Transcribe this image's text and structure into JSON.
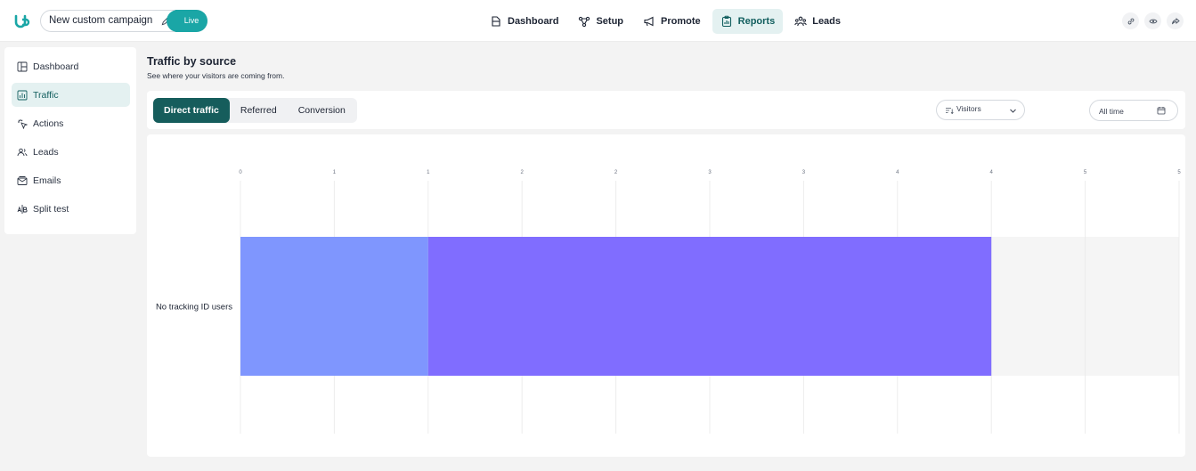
{
  "header": {
    "campaign_name": "New custom campaign",
    "status_label": "Live",
    "nav": [
      {
        "label": "Dashboard",
        "icon": "dashboard-icon",
        "active": false
      },
      {
        "label": "Setup",
        "icon": "setup-icon",
        "active": false
      },
      {
        "label": "Promote",
        "icon": "megaphone-icon",
        "active": false
      },
      {
        "label": "Reports",
        "icon": "clipboard-icon",
        "active": true
      },
      {
        "label": "Leads",
        "icon": "people-icon",
        "active": false
      }
    ],
    "actions": [
      "link-icon",
      "eye-icon",
      "share-icon"
    ]
  },
  "sidebar": {
    "items": [
      {
        "label": "Dashboard",
        "icon": "layout-icon",
        "active": false
      },
      {
        "label": "Traffic",
        "icon": "bar-chart-icon",
        "active": true
      },
      {
        "label": "Actions",
        "icon": "click-icon",
        "active": false
      },
      {
        "label": "Leads",
        "icon": "users-icon",
        "active": false
      },
      {
        "label": "Emails",
        "icon": "mail-icon",
        "active": false
      },
      {
        "label": "Split test",
        "icon": "split-icon",
        "active": false
      }
    ]
  },
  "main": {
    "title": "Traffic by source",
    "subtitle": "See where your visitors are coming from.",
    "tabs": [
      {
        "label": "Direct traffic",
        "active": true
      },
      {
        "label": "Referred",
        "active": false
      },
      {
        "label": "Conversion",
        "active": false
      }
    ],
    "metric_select": "Visitors",
    "date_range": "All time"
  },
  "colors": {
    "accent": "#165d5c",
    "live": "#1aa6a6",
    "bar1": "#7f96fe",
    "bar2": "#806dff"
  },
  "chart_data": {
    "type": "bar",
    "orientation": "horizontal",
    "stacked": true,
    "categories": [
      "No tracking ID users"
    ],
    "series": [
      {
        "values": [
          1
        ],
        "color": "#7f96fe"
      },
      {
        "values": [
          3
        ],
        "color": "#806dff"
      }
    ],
    "x_tick_labels": [
      "0",
      "1",
      "1",
      "2",
      "2",
      "3",
      "3",
      "4",
      "4",
      "5",
      "5"
    ],
    "xlim": [
      0,
      5
    ],
    "grid": true
  }
}
